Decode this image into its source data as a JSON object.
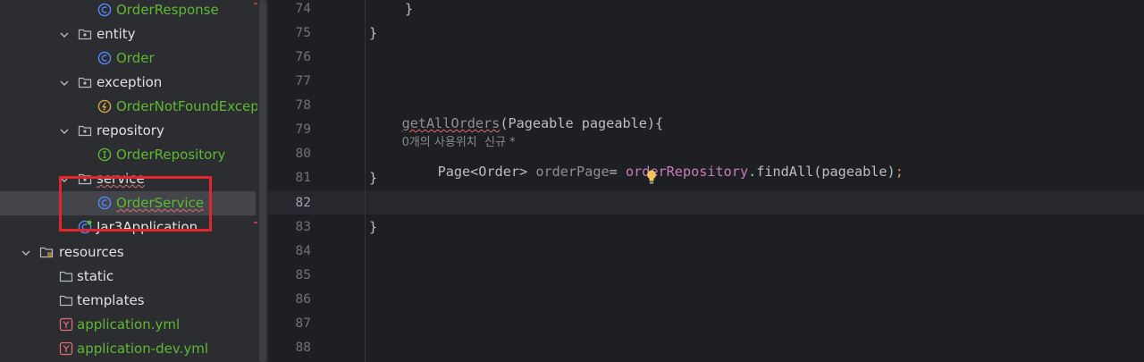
{
  "tree": {
    "items": [
      {
        "label": "OrderResponse"
      },
      {
        "label": "entity"
      },
      {
        "label": "Order"
      },
      {
        "label": "exception"
      },
      {
        "label": "OrderNotFoundException"
      },
      {
        "label": "repository"
      },
      {
        "label": "OrderRepository"
      },
      {
        "label": "service"
      },
      {
        "label": "OrderService"
      },
      {
        "label": "Jar3Application"
      },
      {
        "label": "resources"
      },
      {
        "label": "static"
      },
      {
        "label": "templates"
      },
      {
        "label": "application.yml"
      },
      {
        "label": "application-dev.yml"
      }
    ]
  },
  "editor": {
    "line_numbers": [
      "74",
      "75",
      "76",
      "77",
      "78",
      "79",
      "80",
      "81",
      "82",
      "83",
      "84",
      "85",
      "86",
      "87",
      "88"
    ],
    "current_line": "82",
    "code": {
      "l74": "}",
      "l75": "}",
      "l78_method": "getAllOrders",
      "l78_rest": "(Pageable pageable){",
      "l78_hint": "0개의 사용위치  신규 *",
      "l80_type": "Page<Order>",
      "l80_var": "orderPage",
      "l80_eq": "=",
      "l80_field": "orderRepository",
      "l80_call": ".findAll(pageable)",
      "l80_semi": ";",
      "l81": "}",
      "l83": "}"
    }
  },
  "colors": {
    "tree_bg": "#2b2d30",
    "editor_bg": "#1e1f22",
    "green_label": "#5fb832",
    "highlight_box": "#e3242b",
    "field_purple": "#c77dbb"
  }
}
